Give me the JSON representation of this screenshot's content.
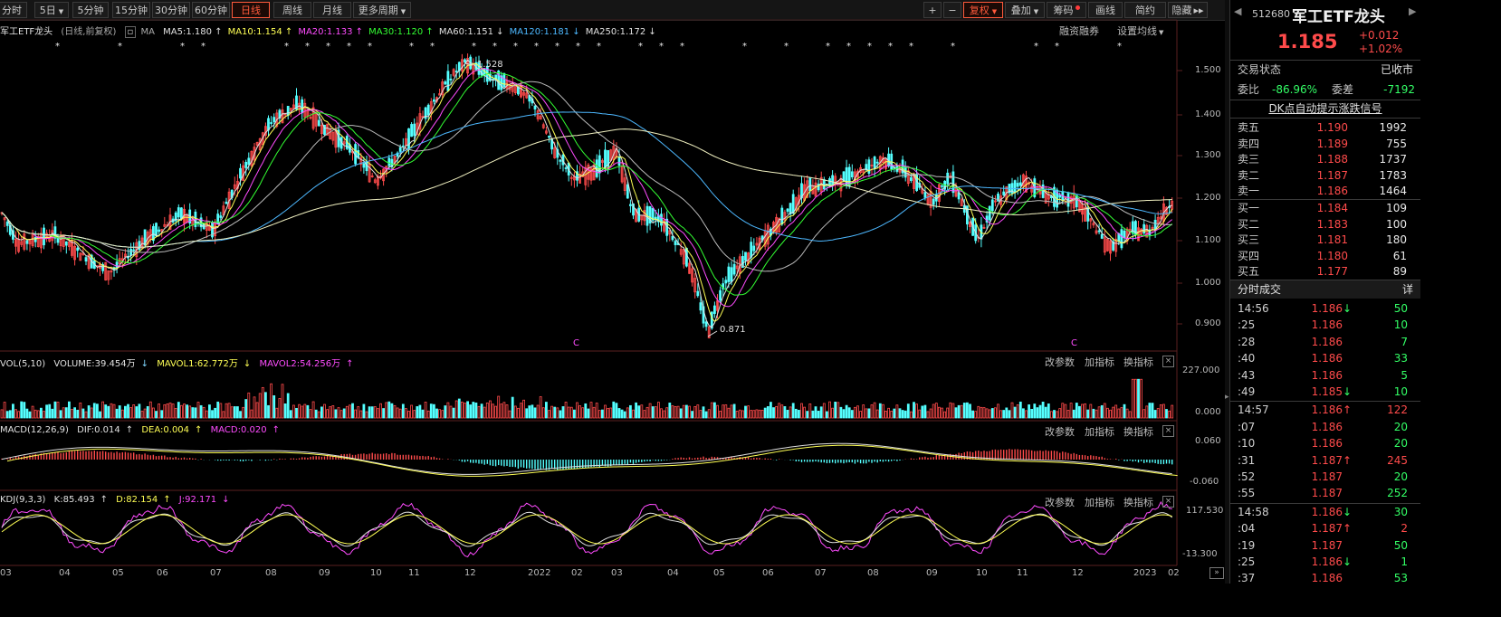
{
  "toolbar": {
    "periods": [
      "分时",
      "5日",
      "5分钟",
      "15分钟",
      "30分钟",
      "60分钟",
      "日线",
      "周线",
      "月线",
      "更多周期"
    ],
    "active_period": "日线",
    "right_buttons": [
      "+",
      "−",
      "复权",
      "叠加",
      "筹码",
      "画线",
      "简约",
      "隐藏"
    ]
  },
  "security": {
    "code": "512680",
    "name": "军工ETF龙头",
    "price": "1.185",
    "change": "+0.012",
    "change_pct": "+1.02%"
  },
  "main_info": {
    "title": "军工ETF龙头",
    "period_note": "(日线,前复权)",
    "ma_label": "MA",
    "ma": [
      {
        "label": "MA5:1.180",
        "dir": "↑",
        "color": "#e0e0e0"
      },
      {
        "label": "MA10:1.154",
        "dir": "↑",
        "color": "#ffff55"
      },
      {
        "label": "MA20:1.133",
        "dir": "↑",
        "color": "#ff4cff"
      },
      {
        "label": "MA30:1.120",
        "dir": "↑",
        "color": "#33ff33"
      },
      {
        "label": "MA60:1.151",
        "dir": "↓",
        "color": "#e0e0e0"
      },
      {
        "label": "MA120:1.181",
        "dir": "↓",
        "color": "#4db8ff"
      },
      {
        "label": "MA250:1.172",
        "dir": "↓",
        "color": "#e0e0e0"
      }
    ],
    "margin_link": "融资融券",
    "settings_link": "设置均线",
    "high_label": "1.528",
    "low_label": "0.871"
  },
  "price_axis": [
    "1.500",
    "1.400",
    "1.300",
    "1.200",
    "1.100",
    "1.000",
    "0.900"
  ],
  "vol_panel": {
    "title": "VOL(5,10)",
    "volume": "VOLUME:39.454万",
    "mavol1": "MAVOL1:62.772万",
    "mavol2": "MAVOL2:54.256万",
    "axis": [
      "227.000",
      "0.000"
    ]
  },
  "macd_panel": {
    "title": "MACD(12,26,9)",
    "dif": "DIF:0.014",
    "dea": "DEA:0.004",
    "macd": "MACD:0.020",
    "axis": [
      "0.060",
      "-0.060"
    ]
  },
  "kdj_panel": {
    "title": "KDJ(9,3,3)",
    "k": "K:85.493",
    "d": "D:82.154",
    "j": "J:92.171",
    "axis": [
      "117.530",
      "-13.300"
    ]
  },
  "panel_links": [
    "改参数",
    "加指标",
    "换指标"
  ],
  "x_axis": [
    "03",
    "04",
    "05",
    "06",
    "07",
    "08",
    "09",
    "10",
    "11",
    "12",
    "2022",
    "02",
    "03",
    "04",
    "05",
    "06",
    "07",
    "08",
    "09",
    "10",
    "11",
    "12",
    "2023",
    "02"
  ],
  "right_panel": {
    "trade_status_label": "交易状态",
    "trade_status": "已收市",
    "weibi_label": "委比",
    "weibi": "-86.96%",
    "weicha_label": "委差",
    "weicha": "-7192",
    "dk_signal": "DK点自动提示涨跌信号",
    "asks": [
      {
        "label": "卖五",
        "price": "1.190",
        "vol": "1992"
      },
      {
        "label": "卖四",
        "price": "1.189",
        "vol": "755"
      },
      {
        "label": "卖三",
        "price": "1.188",
        "vol": "1737"
      },
      {
        "label": "卖二",
        "price": "1.187",
        "vol": "1783"
      },
      {
        "label": "卖一",
        "price": "1.186",
        "vol": "1464"
      }
    ],
    "bids": [
      {
        "label": "买一",
        "price": "1.184",
        "vol": "109"
      },
      {
        "label": "买二",
        "price": "1.183",
        "vol": "100"
      },
      {
        "label": "买三",
        "price": "1.181",
        "vol": "180"
      },
      {
        "label": "买四",
        "price": "1.180",
        "vol": "61"
      },
      {
        "label": "买五",
        "price": "1.177",
        "vol": "89"
      }
    ],
    "ticks_title": "分时成交",
    "ticks_detail": "详",
    "ticks": [
      {
        "time": "14:56",
        "price": "1.186",
        "arrow": "↓",
        "vol": "50",
        "major": true
      },
      {
        "time": ":25",
        "price": "1.186",
        "arrow": "",
        "vol": "10"
      },
      {
        "time": ":28",
        "price": "1.186",
        "arrow": "",
        "vol": "7"
      },
      {
        "time": ":40",
        "price": "1.186",
        "arrow": "",
        "vol": "33"
      },
      {
        "time": ":43",
        "price": "1.186",
        "arrow": "",
        "vol": "5"
      },
      {
        "time": ":49",
        "price": "1.185",
        "arrow": "↓",
        "vol": "10"
      },
      {
        "time": "14:57",
        "price": "1.186",
        "arrow": "↑",
        "vol": "122",
        "major": true
      },
      {
        "time": ":07",
        "price": "1.186",
        "arrow": "",
        "vol": "20"
      },
      {
        "time": ":10",
        "price": "1.186",
        "arrow": "",
        "vol": "20"
      },
      {
        "time": ":31",
        "price": "1.187",
        "arrow": "↑",
        "vol": "245"
      },
      {
        "time": ":52",
        "price": "1.187",
        "arrow": "",
        "vol": "20"
      },
      {
        "time": ":55",
        "price": "1.187",
        "arrow": "",
        "vol": "252"
      },
      {
        "time": "14:58",
        "price": "1.186",
        "arrow": "↓",
        "vol": "30",
        "major": true
      },
      {
        "time": ":04",
        "price": "1.187",
        "arrow": "↑",
        "vol": "2"
      },
      {
        "time": ":19",
        "price": "1.187",
        "arrow": "",
        "vol": "50"
      },
      {
        "time": ":25",
        "price": "1.186",
        "arrow": "↓",
        "vol": "1"
      },
      {
        "time": ":37",
        "price": "1.186",
        "arrow": "",
        "vol": "53"
      }
    ]
  },
  "colors": {
    "up": "#ff4b4b",
    "down": "#54ffff",
    "text": "#c8c8c8",
    "active": "#ff5a3c"
  }
}
